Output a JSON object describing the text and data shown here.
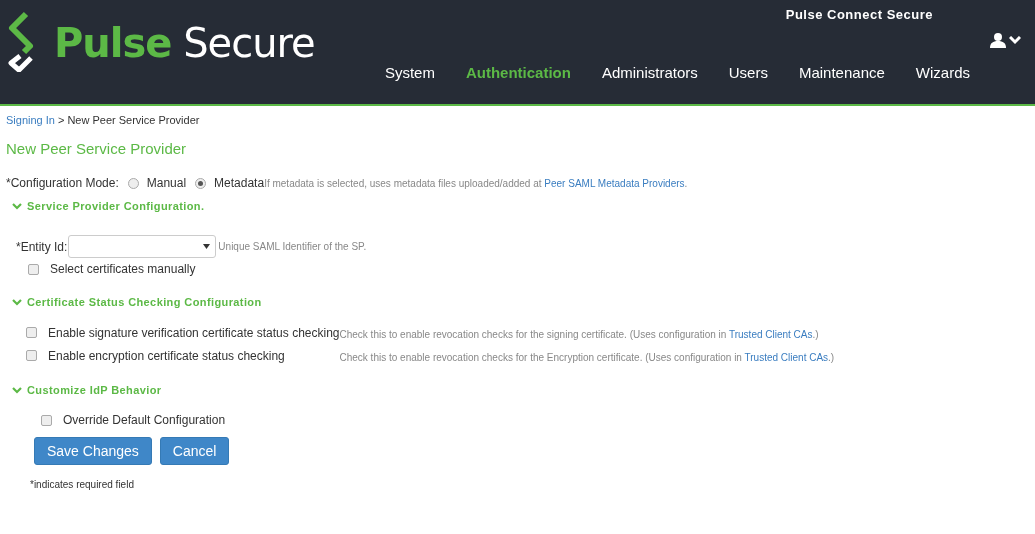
{
  "header": {
    "logo": {
      "part_1": "Pulse",
      "part_2": "Secure"
    },
    "product": "Pulse Connect Secure",
    "nav": [
      {
        "label": "System",
        "selected": false
      },
      {
        "label": "Authentication",
        "selected": true
      },
      {
        "label": "Administrators",
        "selected": false
      },
      {
        "label": "Users",
        "selected": false
      },
      {
        "label": "Maintenance",
        "selected": false
      },
      {
        "label": "Wizards",
        "selected": false
      }
    ]
  },
  "breadcrumb": {
    "link": "Signing In",
    "separator": ">",
    "current": "New Peer Service Provider"
  },
  "page_title": "New Peer Service Provider",
  "configuration_mode": {
    "label": "*Configuration Mode:",
    "options": [
      {
        "label": "Manual",
        "selected": false
      },
      {
        "label": "Metadata",
        "selected": true
      }
    ],
    "hint": {
      "text": "If metadata is selected, uses metadata files uploaded/added at ",
      "link": "Peer SAML Metadata Providers",
      "tail": "."
    }
  },
  "sections": [
    {
      "title": "Service Provider Configuration.",
      "expanded": true,
      "kind": "entity",
      "entity_label": "*Entity Id:",
      "entity_hint": "Unique SAML Identifier of the SP.",
      "checkboxes": [
        {
          "label": "Select certificates manually",
          "checked": false
        }
      ]
    },
    {
      "title": "Certificate Status Checking Configuration",
      "expanded": true,
      "kind": "checks",
      "checkboxes": [
        {
          "label": "Enable signature verification certificate status checking",
          "checked": false,
          "hint": {
            "text": "Check this to enable revocation checks for the signing certificate. (Uses configuration in ",
            "link": "Trusted Client CAs",
            "tail": ".)"
          }
        },
        {
          "label": "Enable encryption certificate status checking",
          "checked": false,
          "hint": {
            "text": "Check this to enable revocation checks for the Encryption certificate. (Uses configuration in ",
            "link": "Trusted Client CAs",
            "tail": ".)"
          }
        }
      ]
    },
    {
      "title": "Customize IdP Behavior",
      "expanded": true,
      "kind": "override",
      "checkboxes": [
        {
          "label": "Override Default Configuration",
          "checked": false
        }
      ]
    }
  ],
  "buttons": [
    "Save Changes",
    "Cancel"
  ],
  "footnote": "*indicates required field"
}
